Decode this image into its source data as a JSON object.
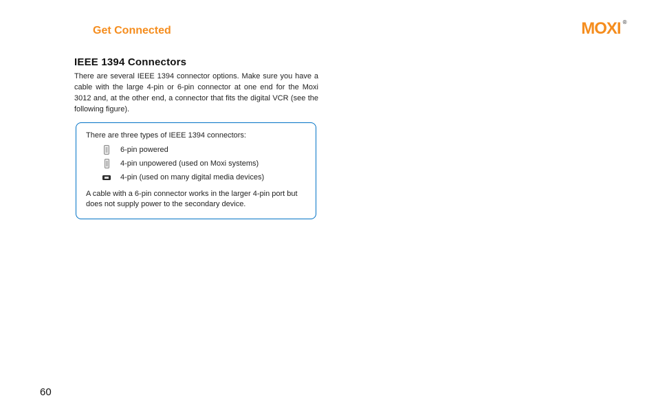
{
  "header": {
    "section_title": "Get Connected",
    "logo_text": "MOXI"
  },
  "content": {
    "heading": "IEEE 1394 Connectors",
    "body": "There are several IEEE 1394 connector options. Make sure you have a cable with the large 4-pin or 6-pin connector at one end for the Moxi 3012 and, at the other end, a connector that fits the digital VCR (see the following figure)."
  },
  "callout": {
    "intro": "There are three types of IEEE 1394 connectors:",
    "items": [
      {
        "label": "6-pin powered",
        "icon": "connector-6pin-icon"
      },
      {
        "label": "4-pin unpowered (used on Moxi systems)",
        "icon": "connector-4pin-tall-icon"
      },
      {
        "label": "4-pin (used on many digital media devices)",
        "icon": "connector-4pin-small-icon"
      }
    ],
    "footer": "A cable with a 6-pin connector works in the larger 4-pin port but does not supply power to the secondary device."
  },
  "page_number": "60"
}
